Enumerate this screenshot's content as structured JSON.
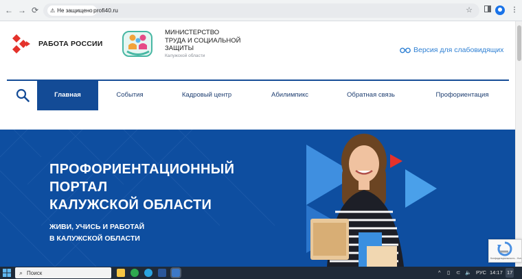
{
  "browser": {
    "security_label": "Не защищено",
    "url": "profi40.ru",
    "back_icon": "arrow-left-icon",
    "forward_icon": "arrow-right-icon",
    "reload_icon": "reload-icon"
  },
  "header": {
    "logo_text": "РАБОТА РОССИИ",
    "ministry_lines": [
      "МИНИСТЕРСТВО",
      "ТРУДА И СОЦИАЛЬНОЙ",
      "ЗАЩИТЫ"
    ],
    "ministry_sub": "Калужской области",
    "accessibility_label": "Версия для слабовидящих"
  },
  "menu": {
    "items": [
      "Главная",
      "События",
      "Кадровый центр",
      "Абилимпикс",
      "Обратная связь",
      "Профориентация"
    ],
    "active_index": 0
  },
  "hero": {
    "title_lines": [
      "ПРОФОРИЕНТАЦИОННЫЙ",
      "ПОРТАЛ",
      "КАЛУЖСКОЙ ОБЛАСТИ"
    ],
    "subtitle_lines": [
      "ЖИВИ, УЧИСЬ И РАБОТАЙ",
      "В КАЛУЖСКОЙ ОБЛАСТИ"
    ]
  },
  "recaptcha": {
    "text": "Конфиденциальность - Условия использования"
  },
  "taskbar": {
    "search_label": "Поиск",
    "language": "РУС",
    "time": "14:17",
    "notifications": "17"
  },
  "colors": {
    "brand_blue": "#134b96",
    "hero_blue": "#0e4ea0",
    "accent_red": "#e4322b",
    "link_blue": "#2d7fd3"
  }
}
